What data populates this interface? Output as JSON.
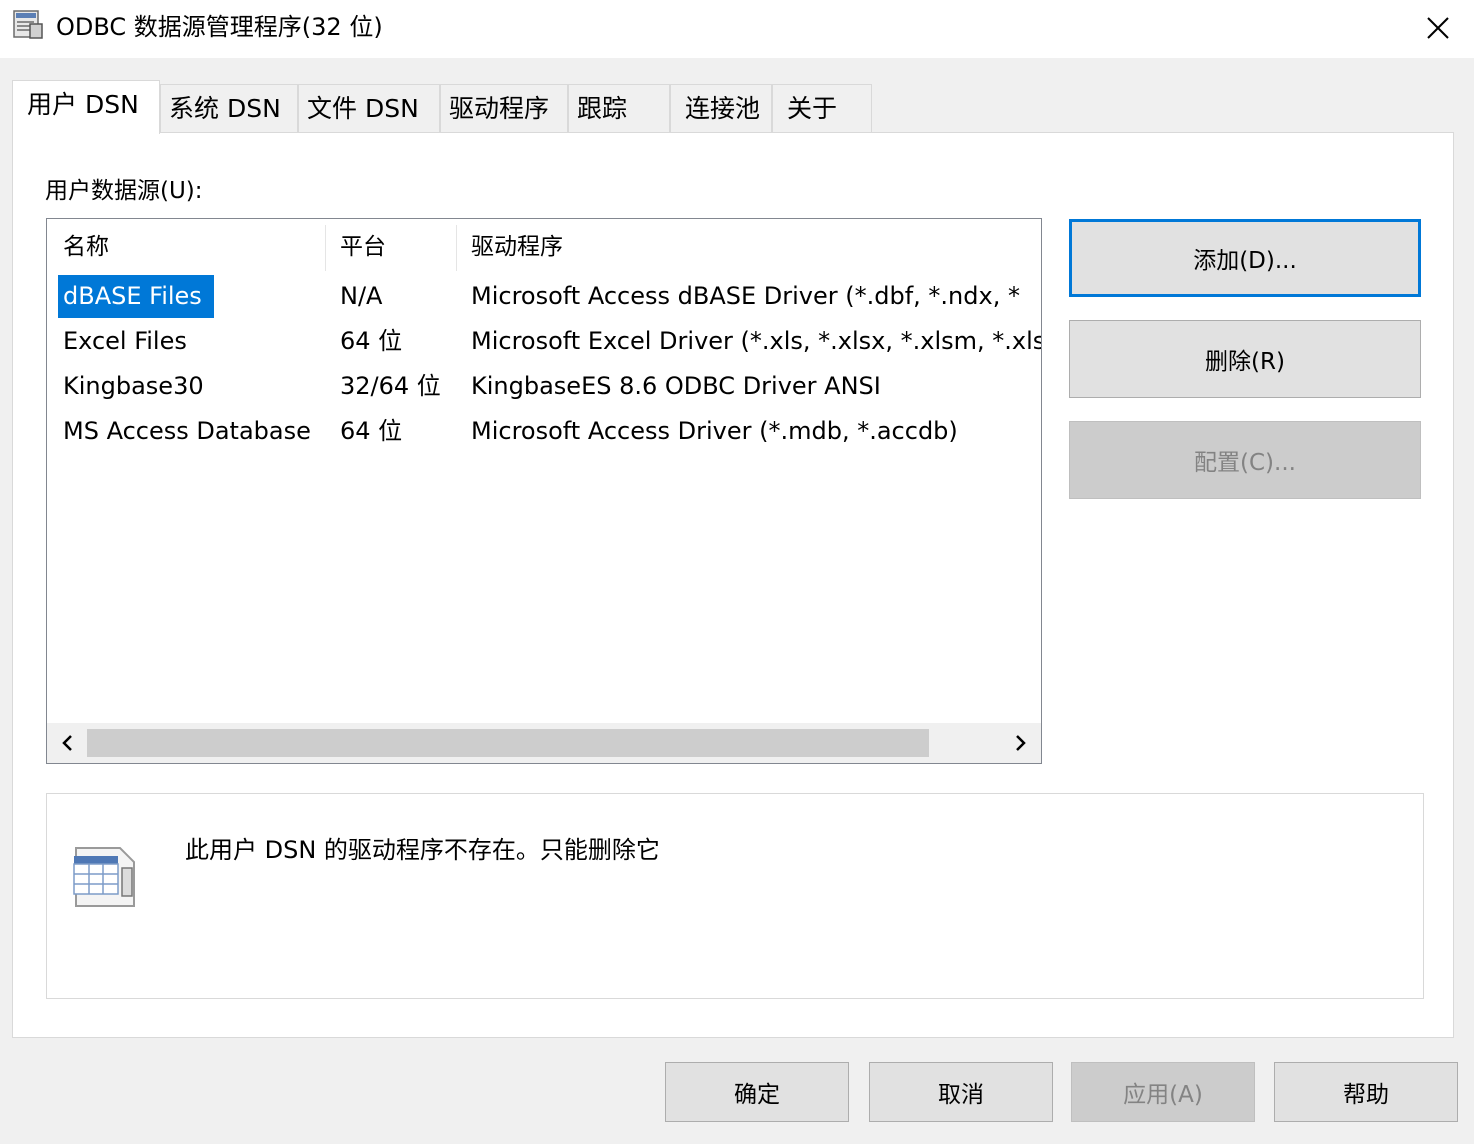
{
  "window": {
    "title": "ODBC 数据源管理程序(32 位)",
    "icon": "odbc-app-icon",
    "close_icon": "close-icon"
  },
  "tabs": [
    {
      "label": "用户 DSN",
      "active": true
    },
    {
      "label": "系统 DSN",
      "active": false
    },
    {
      "label": "文件 DSN",
      "active": false
    },
    {
      "label": "驱动程序",
      "active": false
    },
    {
      "label": "跟踪",
      "active": false
    },
    {
      "label": "连接池",
      "active": false
    },
    {
      "label": "关于",
      "active": false
    }
  ],
  "user_dsn": {
    "section_label": "用户数据源(U):",
    "columns": {
      "name": "名称",
      "platform": "平台",
      "driver": "驱动程序"
    },
    "rows": [
      {
        "name": "dBASE Files",
        "platform": "N/A",
        "driver": "Microsoft Access dBASE Driver (*.dbf, *.ndx, *",
        "selected": true
      },
      {
        "name": "Excel Files",
        "platform": "64 位",
        "driver": "Microsoft Excel Driver (*.xls, *.xlsx, *.xlsm, *.xls",
        "selected": false
      },
      {
        "name": "Kingbase30",
        "platform": "32/64 位",
        "driver": "KingbaseES 8.6 ODBC Driver ANSI",
        "selected": false
      },
      {
        "name": "MS Access Database",
        "platform": "64 位",
        "driver": "Microsoft Access Driver (*.mdb, *.accdb)",
        "selected": false
      }
    ],
    "buttons": {
      "add": "添加(D)...",
      "remove": "删除(R)",
      "configure": "配置(C)..."
    },
    "info_text": "此用户 DSN 的驱动程序不存在。只能删除它",
    "info_icon": "odbc-datasource-icon"
  },
  "footer_buttons": {
    "ok": "确定",
    "cancel": "取消",
    "apply": "应用(A)",
    "help": "帮助"
  },
  "colors": {
    "selection": "#0078d7",
    "default_button_border": "#0078d7"
  }
}
